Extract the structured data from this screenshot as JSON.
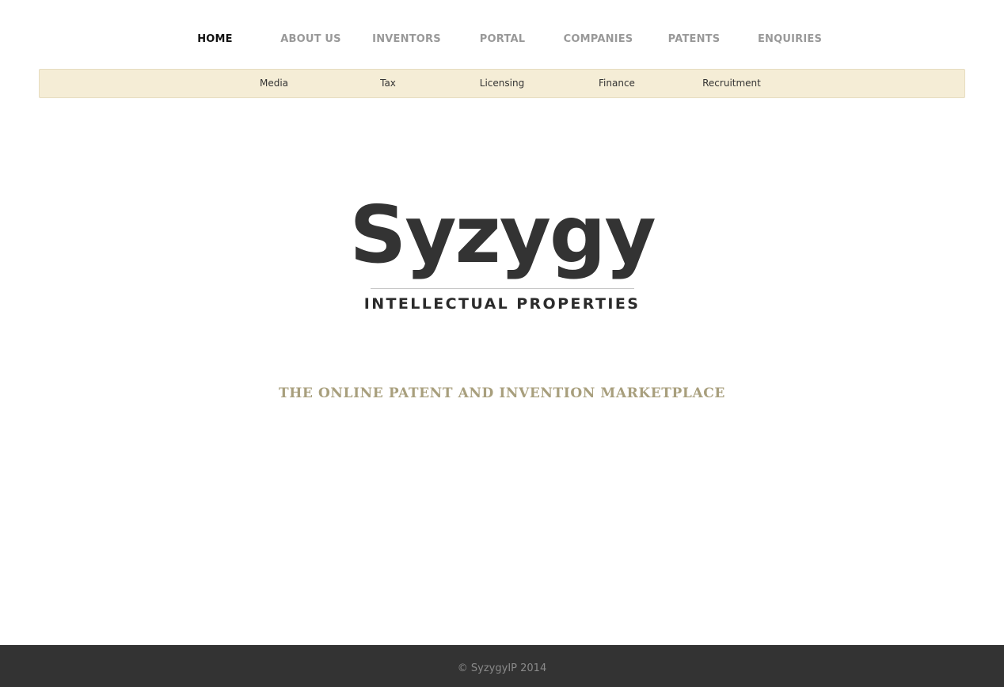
{
  "main_nav": {
    "items": [
      {
        "label": "HOME",
        "active": true
      },
      {
        "label": "ABOUT US",
        "active": false
      },
      {
        "label": "INVENTORS",
        "active": false
      },
      {
        "label": "PORTAL",
        "active": false
      },
      {
        "label": "COMPANIES",
        "active": false
      },
      {
        "label": "PATENTS",
        "active": false
      },
      {
        "label": "ENQUIRIES",
        "active": false
      }
    ]
  },
  "sub_nav": {
    "items": [
      {
        "label": "Media"
      },
      {
        "label": "Tax"
      },
      {
        "label": "Licensing"
      },
      {
        "label": "Finance"
      },
      {
        "label": "Recruitment"
      }
    ]
  },
  "logo": {
    "name": "Syzygy",
    "subtitle": "INTELLECTUAL PROPERTIES"
  },
  "tagline": "THE ONLINE PATENT AND INVENTION MARKETPLACE",
  "footer": {
    "copyright": "© SyzygyIP 2014"
  },
  "colors": {
    "subnav_background": "#f5edd6",
    "tagline": "#a89f7d",
    "footer_background": "#333333",
    "nav_inactive": "#999999",
    "nav_active": "#111111"
  }
}
